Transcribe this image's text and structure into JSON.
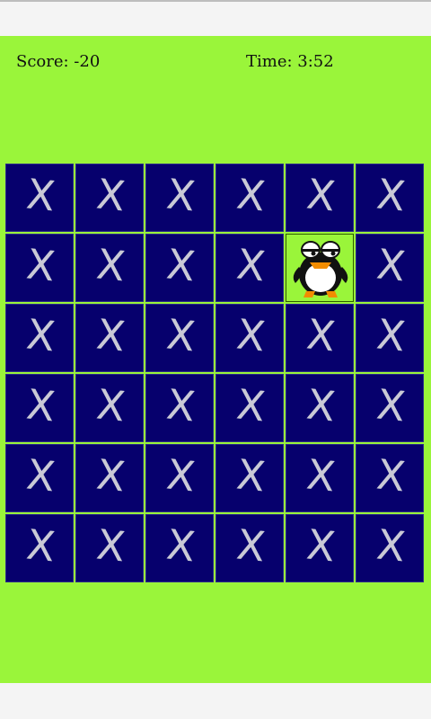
{
  "hud": {
    "score_text": "Score: -20",
    "time_text": "Time: 3:52"
  },
  "board": {
    "rows": 6,
    "cols": 6,
    "hidden_symbol": "X",
    "revealed": [
      {
        "row": 1,
        "col": 4,
        "icon": "penguin-icon"
      }
    ]
  },
  "colors": {
    "background": "#9af53a",
    "tile": "#06006d",
    "x_mark": "#c9c9d6"
  }
}
